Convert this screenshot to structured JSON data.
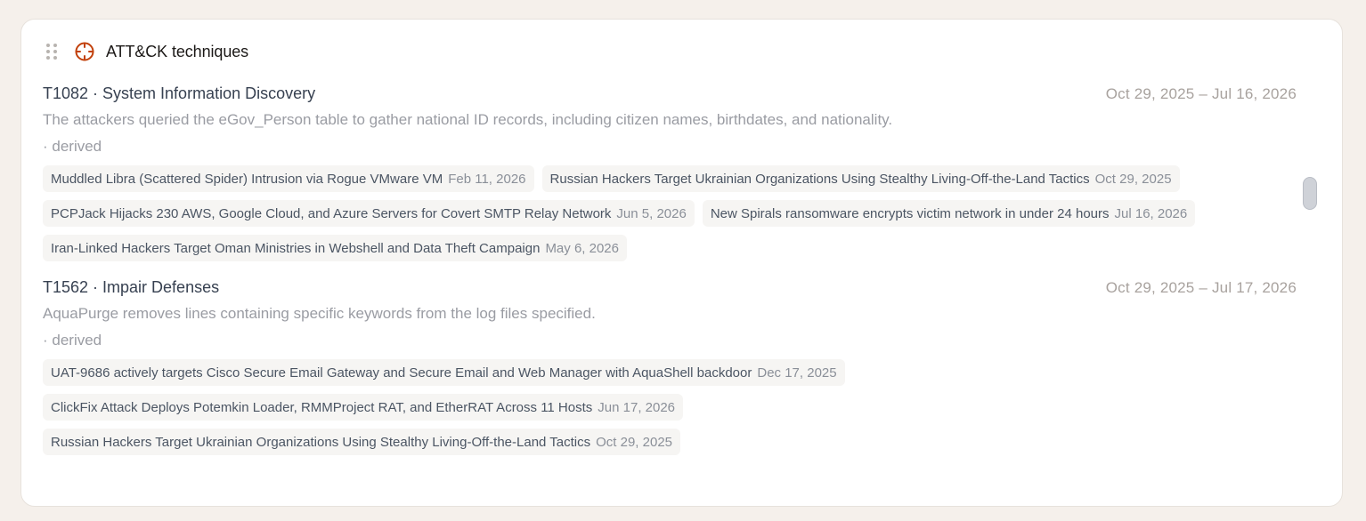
{
  "card": {
    "title": "ATT&CK techniques",
    "icon": "target-icon",
    "accent_color": "#c2410c"
  },
  "techniques": [
    {
      "title": "T1082 · System Information Discovery",
      "range": "Oct 29, 2025 – Jul 16, 2026",
      "description": "The attackers queried the eGov_Person table to gather national ID records, including citizen names, birthdates, and nationality.",
      "derived": "· derived",
      "reports": [
        {
          "title": "Muddled Libra (Scattered Spider) Intrusion via Rogue VMware VM",
          "date": "Feb 11, 2026"
        },
        {
          "title": "Russian Hackers Target Ukrainian Organizations Using Stealthy Living-Off-the-Land Tactics",
          "date": "Oct 29, 2025"
        },
        {
          "title": "PCPJack Hijacks 230 AWS, Google Cloud, and Azure Servers for Covert SMTP Relay Network",
          "date": "Jun 5, 2026"
        },
        {
          "title": "New Spirals ransomware encrypts victim network in under 24 hours",
          "date": "Jul 16, 2026"
        },
        {
          "title": "Iran-Linked Hackers Target Oman Ministries in Webshell and Data Theft Campaign",
          "date": "May 6, 2026"
        }
      ]
    },
    {
      "title": "T1562 · Impair Defenses",
      "range": "Oct 29, 2025 – Jul 17, 2026",
      "description": "AquaPurge removes lines containing specific keywords from the log files specified.",
      "derived": "· derived",
      "reports": [
        {
          "title": "UAT-9686 actively targets Cisco Secure Email Gateway and Secure Email and Web Manager with AquaShell backdoor",
          "date": "Dec 17, 2025"
        },
        {
          "title": "ClickFix Attack Deploys Potemkin Loader, RMMProject RAT, and EtherRAT Across 11 Hosts",
          "date": "Jun 17, 2026"
        },
        {
          "title": "Russian Hackers Target Ukrainian Organizations Using Stealthy Living-Off-the-Land Tactics",
          "date": "Oct 29, 2025"
        }
      ]
    }
  ]
}
